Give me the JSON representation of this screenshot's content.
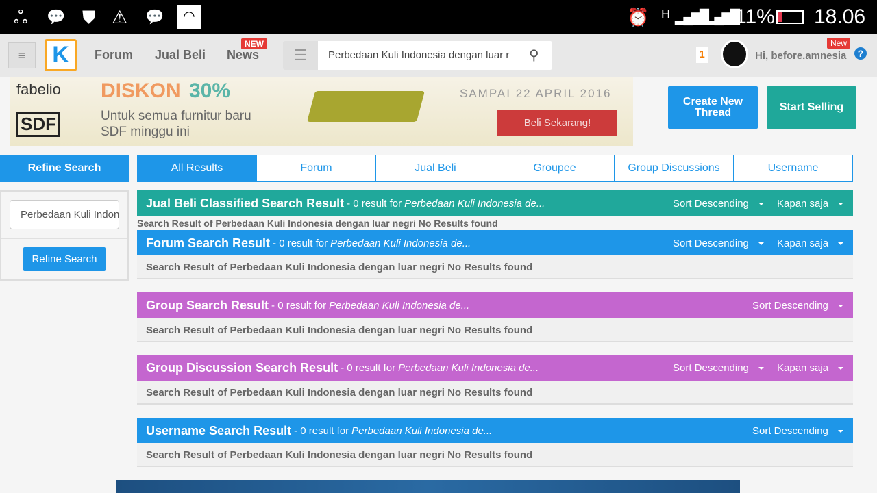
{
  "status_bar": {
    "icons": [
      "cloud-icon",
      "bbm-notification-icon",
      "shield-icon",
      "warning-icon",
      "bbm-icon",
      "wifi-icon",
      "alarm-icon",
      "signal-h-icon",
      "signal-icon",
      "battery-icon"
    ],
    "network": "H",
    "battery": "11%",
    "time": "18.06"
  },
  "nav": {
    "links": [
      "Forum",
      "Jual Beli",
      "News"
    ],
    "news_badge": "NEW",
    "search_value": "Perbedaan Kuli Indonesia dengan luar r",
    "notif_count": "1",
    "greeting": "Hi, before.amnesia",
    "user_badge": "New"
  },
  "ad": {
    "brand1": "fabelio",
    "brand2": "SDF",
    "headline_a": "DISKON",
    "headline_b": "30%",
    "line1": "Untuk semua furnitur baru",
    "line2": "SDF minggu ini",
    "until": "SAMPAI 22 APRIL 2016",
    "cta": "Beli Sekarang!"
  },
  "actions": {
    "create": "Create New Thread",
    "sell": "Start Selling"
  },
  "refine": {
    "title": "Refine Search",
    "input_value": "Perbedaan Kuli Indonesia dengan luar negri",
    "button": "Refine Search"
  },
  "tabs": [
    "All Results",
    "Forum",
    "Jual Beli",
    "Groupee",
    "Group Discussions",
    "Username"
  ],
  "colors": {
    "blue": "#1e96e8",
    "teal": "#20a89b",
    "purple": "#c466cf"
  },
  "sections": [
    {
      "title": "Jual Beli Classified Search Result",
      "count": "- 0 result for",
      "query": "Perbedaan Kuli Indonesia de...",
      "sort": "Sort Descending",
      "time": "Kapan saja",
      "body": "Search Result of Perbedaan Kuli Indonesia dengan luar negri No Results found"
    },
    {
      "title": "Forum Search Result",
      "count": "- 0 result for",
      "query": "Perbedaan Kuli Indonesia de...",
      "sort": "Sort Descending",
      "time": "Kapan saja",
      "body": "Search Result of Perbedaan Kuli Indonesia dengan luar negri No Results found"
    },
    {
      "title": "Group Search Result",
      "count": "- 0 result for",
      "query": "Perbedaan Kuli Indonesia de...",
      "sort": "Sort Descending",
      "body": "Search Result of Perbedaan Kuli Indonesia dengan luar negri No Results found"
    },
    {
      "title": "Group Discussion Search Result",
      "count": "- 0 result for",
      "query": "Perbedaan Kuli Indonesia de...",
      "sort": "Sort Descending",
      "time": "Kapan saja",
      "body": "Search Result of Perbedaan Kuli Indonesia dengan luar negri No Results found"
    },
    {
      "title": "Username Search Result",
      "count": "- 0 result for",
      "query": "Perbedaan Kuli Indonesia de...",
      "sort": "Sort Descending",
      "body": "Search Result of Perbedaan Kuli Indonesia dengan luar negri No Results found"
    }
  ]
}
